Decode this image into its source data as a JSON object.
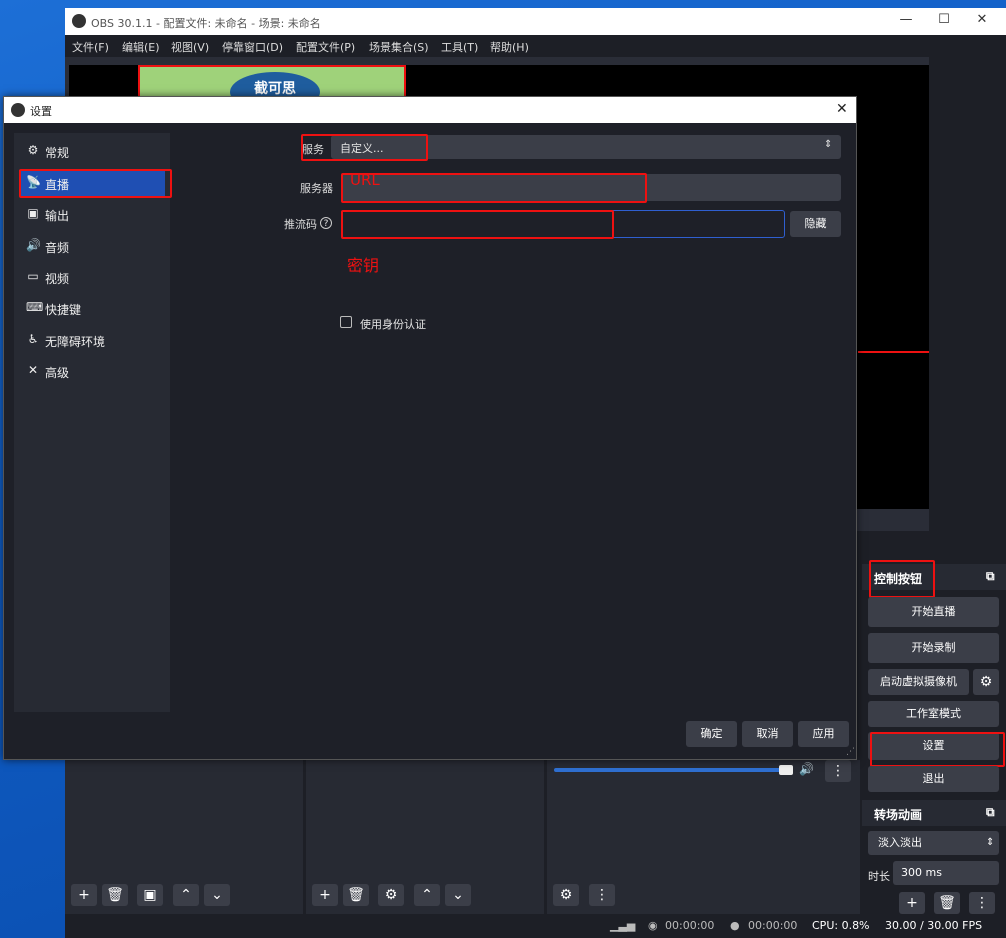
{
  "obs": {
    "title": "OBS 30.1.1 - 配置文件: 未命名 - 场景: 未命名",
    "menu": [
      "文件(F)",
      "编辑(E)",
      "视图(V)",
      "停靠窗口(D)",
      "配置文件(P)",
      "场景集合(S)",
      "工具(T)",
      "帮助(H)"
    ],
    "source_text": "截可思",
    "controls": {
      "title": "控制按钮",
      "start_stream": "开始直播",
      "start_record": "开始录制",
      "virtual_cam": "启动虚拟摄像机",
      "studio_mode": "工作室模式",
      "settings": "设置",
      "exit": "退出"
    },
    "transitions": {
      "title": "转场动画",
      "type": "淡入淡出",
      "duration_label": "时长",
      "duration_value": "300 ms"
    },
    "status": {
      "stream_time": "00:00:00",
      "record_time": "00:00:00",
      "cpu": "CPU: 0.8%",
      "fps": "30.00 / 30.00 FPS"
    }
  },
  "dialog": {
    "title": "设置",
    "sidebar": [
      {
        "label": "常规",
        "icon": "⚙"
      },
      {
        "label": "直播",
        "icon": "📡"
      },
      {
        "label": "输出",
        "icon": "▣"
      },
      {
        "label": "音频",
        "icon": "🔊"
      },
      {
        "label": "视频",
        "icon": "▭"
      },
      {
        "label": "快捷键",
        "icon": "⌨"
      },
      {
        "label": "无障碍环境",
        "icon": "♿"
      },
      {
        "label": "高级",
        "icon": "✕"
      }
    ],
    "service_label": "服务",
    "service_value": "自定义...",
    "server_label": "服务器",
    "server_placeholder": "URL",
    "key_label": "推流码",
    "key_annotation": "密钥",
    "hide_button": "隐藏",
    "auth_label": "使用身份认证",
    "ok": "确定",
    "cancel": "取消",
    "apply": "应用"
  },
  "colors": {
    "accent": "#1f4fb3",
    "highlight": "#e11111"
  }
}
